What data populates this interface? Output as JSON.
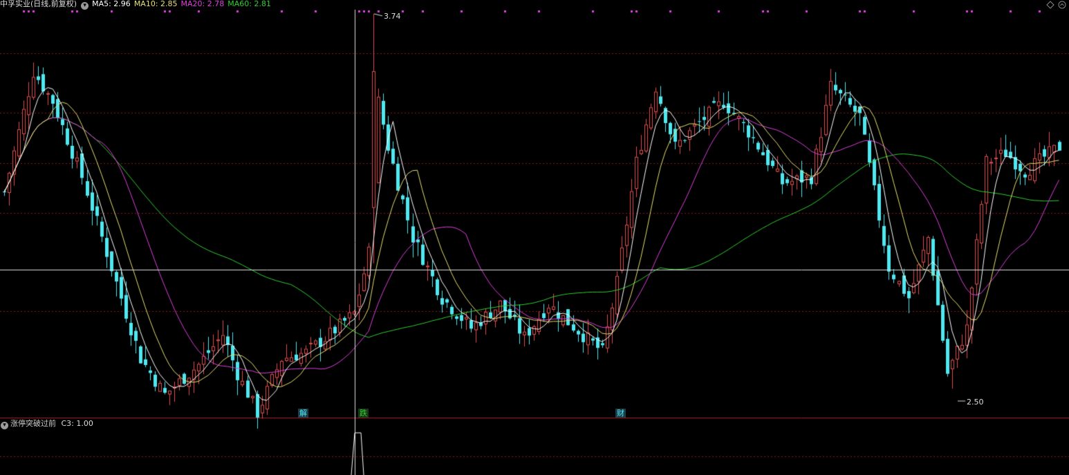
{
  "header": {
    "name": "中孚实业(日线,前复权)",
    "ma5": "MA5: 2.96",
    "ma10": "MA10: 2.85",
    "ma20": "MA20: 2.78",
    "ma60": "MA60: 2.81"
  },
  "colors": {
    "ma5": "#ffffff",
    "ma10": "#e8e070",
    "ma20": "#e040e0",
    "ma60": "#30d030",
    "up": "#e05050",
    "down": "#50e8f0",
    "grid": "#8b1a1a",
    "marker": "#e040e0"
  },
  "labels": {
    "max": "3.74",
    "min": "2.50",
    "tag1": "解",
    "tag2": "跌",
    "tag3": "财"
  },
  "subpanel": {
    "title": "涨停突破过前",
    "c3": "C3: 1.00"
  },
  "icons": [
    "dropdown-circle-icon",
    "diamond-icon",
    "chevron-up-circle-icon"
  ],
  "chart_data": {
    "type": "candlestick",
    "series": [
      {
        "name": "MA5",
        "current": 2.96
      },
      {
        "name": "MA10",
        "current": 2.85
      },
      {
        "name": "MA20",
        "current": 2.78
      },
      {
        "name": "MA60",
        "current": 2.81
      }
    ],
    "annotations": {
      "max": 3.74,
      "min": 2.5,
      "crosshair_y": 2.81
    },
    "subchart": {
      "name": "涨停突破过前",
      "C3": 1.0
    }
  }
}
